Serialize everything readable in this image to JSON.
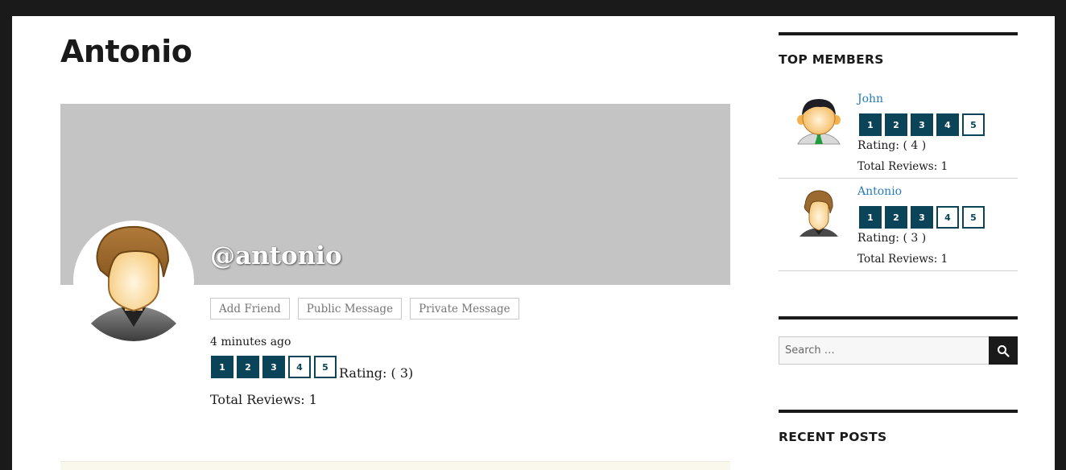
{
  "profile": {
    "title": "Antonio",
    "handle": "@antonio",
    "actions": {
      "add_friend": "Add Friend",
      "public_message": "Public Message",
      "private_message": "Private Message"
    },
    "last_active": "4 minutes ago",
    "stars": [
      "1",
      "2",
      "3",
      "4",
      "5"
    ],
    "rating_value": 3,
    "rating_text": "Rating: ( 3)",
    "total_reviews": "Total Reviews: 1"
  },
  "sidebar": {
    "top_members": {
      "title": "TOP MEMBERS",
      "members": [
        {
          "name": "John",
          "stars": [
            "1",
            "2",
            "3",
            "4",
            "5"
          ],
          "rating_value": 4,
          "rating_text": "Rating: ( 4 )",
          "total_reviews": "Total Reviews: 1",
          "avatar": "male-avatar-green-tie-icon"
        },
        {
          "name": "Antonio",
          "stars": [
            "1",
            "2",
            "3",
            "4",
            "5"
          ],
          "rating_value": 3,
          "rating_text": "Rating: ( 3 )",
          "total_reviews": "Total Reviews: 1",
          "avatar": "male-avatar-brown-hair-icon"
        }
      ]
    },
    "search": {
      "placeholder": "Search …",
      "button_icon": "search-icon"
    },
    "recent_posts": {
      "title": "RECENT POSTS"
    }
  },
  "colors": {
    "star_active": "#0b4358",
    "cover": "#c4c4c4",
    "link": "#2b7bb9",
    "frame": "#1a1a1a"
  }
}
